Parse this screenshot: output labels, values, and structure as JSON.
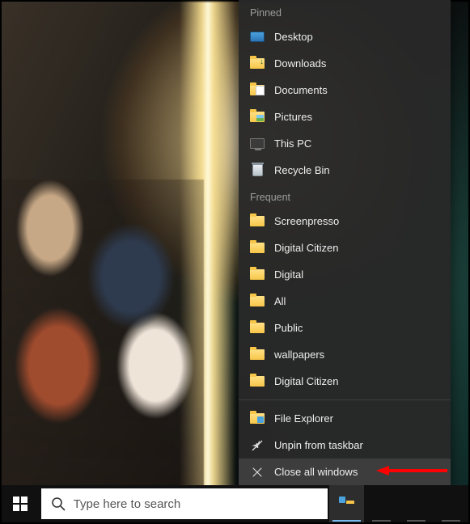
{
  "jumplist": {
    "groups": [
      {
        "header": "Pinned",
        "items": [
          {
            "icon": "desktop-icon",
            "label": "Desktop"
          },
          {
            "icon": "downloads-icon",
            "label": "Downloads"
          },
          {
            "icon": "documents-icon",
            "label": "Documents"
          },
          {
            "icon": "pictures-icon",
            "label": "Pictures"
          },
          {
            "icon": "this-pc-icon",
            "label": "This PC"
          },
          {
            "icon": "recycle-bin-icon",
            "label": "Recycle Bin"
          }
        ]
      },
      {
        "header": "Frequent",
        "items": [
          {
            "icon": "folder-icon",
            "label": "Screenpresso"
          },
          {
            "icon": "folder-icon",
            "label": "Digital Citizen"
          },
          {
            "icon": "folder-icon",
            "label": "Digital"
          },
          {
            "icon": "folder-icon",
            "label": "All"
          },
          {
            "icon": "folder-icon",
            "label": "Public"
          },
          {
            "icon": "folder-icon",
            "label": "wallpapers"
          },
          {
            "icon": "folder-icon",
            "label": "Digital Citizen"
          }
        ]
      }
    ],
    "bottom": [
      {
        "icon": "file-explorer-icon",
        "label": "File Explorer"
      },
      {
        "icon": "unpin-icon",
        "label": "Unpin from taskbar"
      },
      {
        "icon": "close-icon",
        "label": "Close all windows",
        "highlight": true
      }
    ]
  },
  "taskbar": {
    "search_placeholder": "Type here to search",
    "buttons": [
      {
        "name": "file-explorer-taskbar-button",
        "icon": "file-explorer-icon",
        "active": true
      },
      {
        "name": "firefox-taskbar-button",
        "icon": "firefox-icon"
      },
      {
        "name": "slack-taskbar-button",
        "icon": "slack-icon"
      },
      {
        "name": "chrome-taskbar-button",
        "icon": "chrome-icon"
      }
    ]
  },
  "annotation": {
    "arrow_color": "#ff0000"
  }
}
